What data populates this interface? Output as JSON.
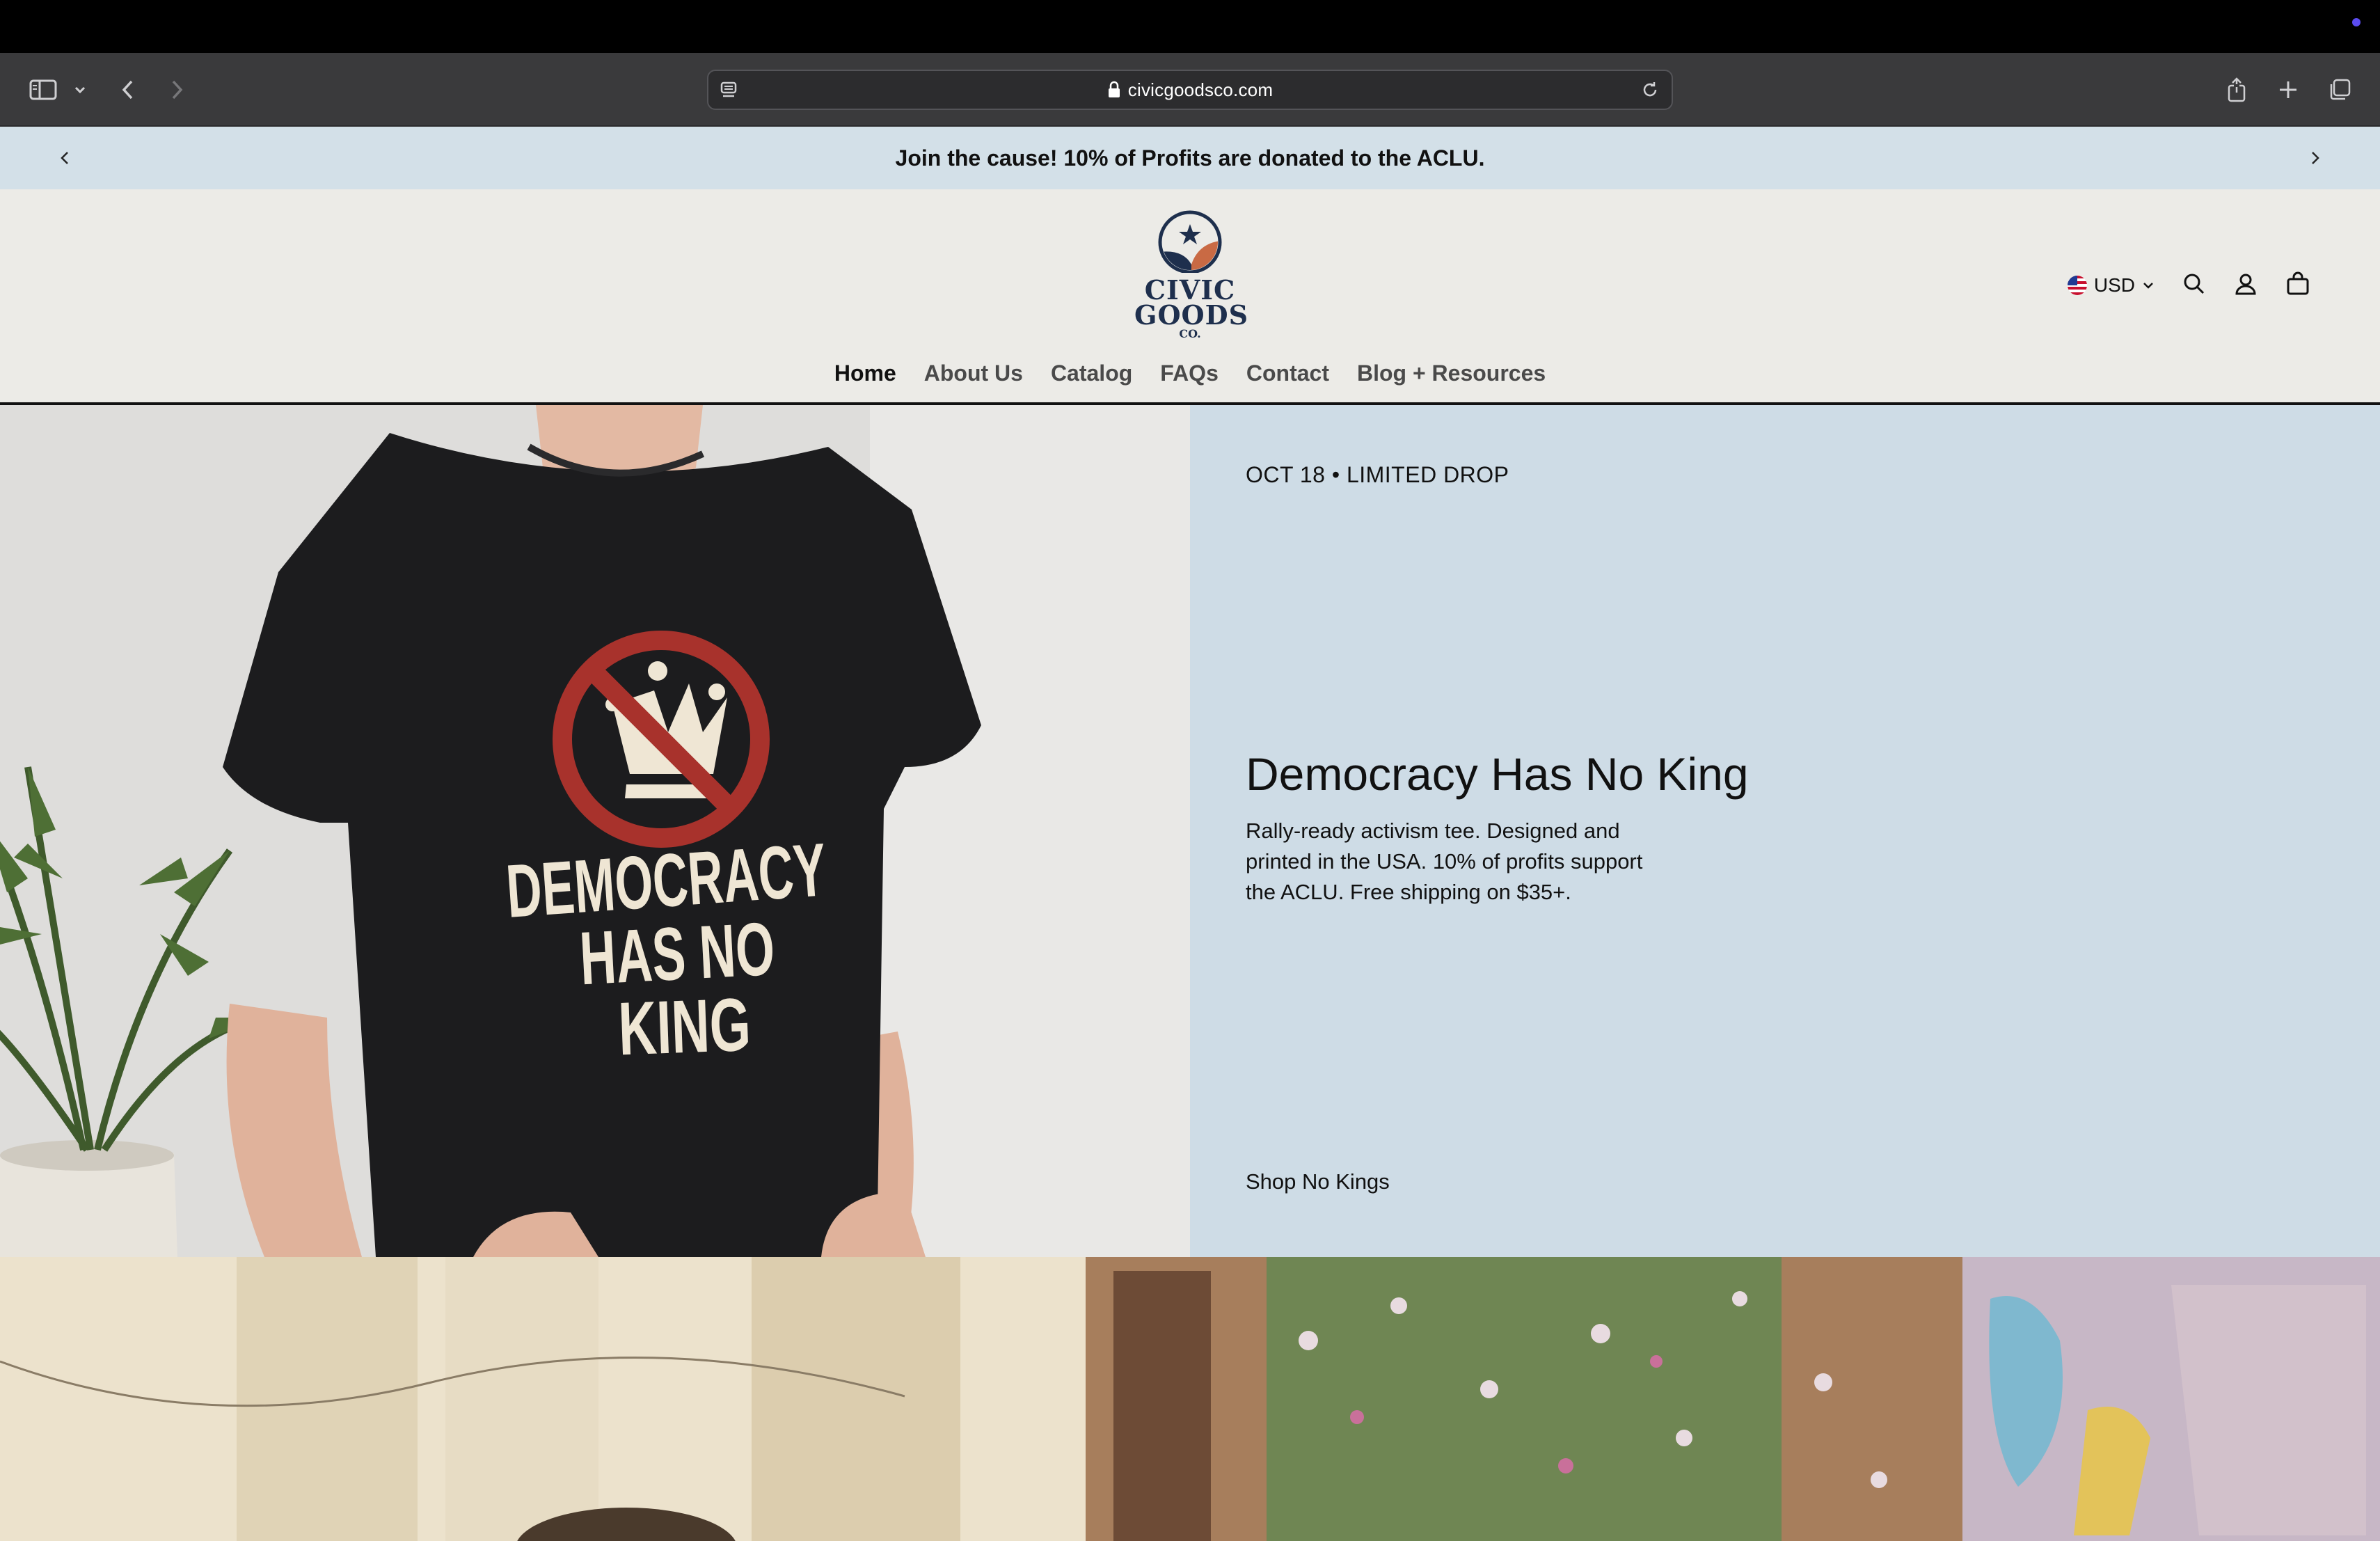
{
  "browser": {
    "url": "civicgoodsco.com"
  },
  "announcement": {
    "text": "Join the cause! 10% of Profits are donated to the ACLU."
  },
  "logo": {
    "line1": "CIVIC",
    "line2": "GOODS",
    "line3": "CO."
  },
  "nav": {
    "items": [
      {
        "label": "Home"
      },
      {
        "label": "About Us"
      },
      {
        "label": "Catalog"
      },
      {
        "label": "FAQs"
      },
      {
        "label": "Contact"
      },
      {
        "label": "Blog + Resources"
      }
    ]
  },
  "header": {
    "currency": "USD"
  },
  "hero": {
    "eyebrow": "OCT 18 • LIMITED DROP",
    "title": "Democracy Has No King",
    "description": "Rally-ready activism tee. Designed and printed in the USA. 10% of profits support the ACLU. Free shipping on $35+.",
    "cta": "Shop No Kings",
    "shirt_line1": "DEMOCRACY",
    "shirt_line2": "HAS NO",
    "shirt_line3": "KING"
  },
  "colors": {
    "announcement_bg": "#d3e0e8",
    "header_bg": "#ecebe7",
    "hero_panel_bg": "#cedce6",
    "logo_navy": "#1e2f4d",
    "logo_terracotta": "#c96a44",
    "shirt_red": "#a8322c"
  }
}
